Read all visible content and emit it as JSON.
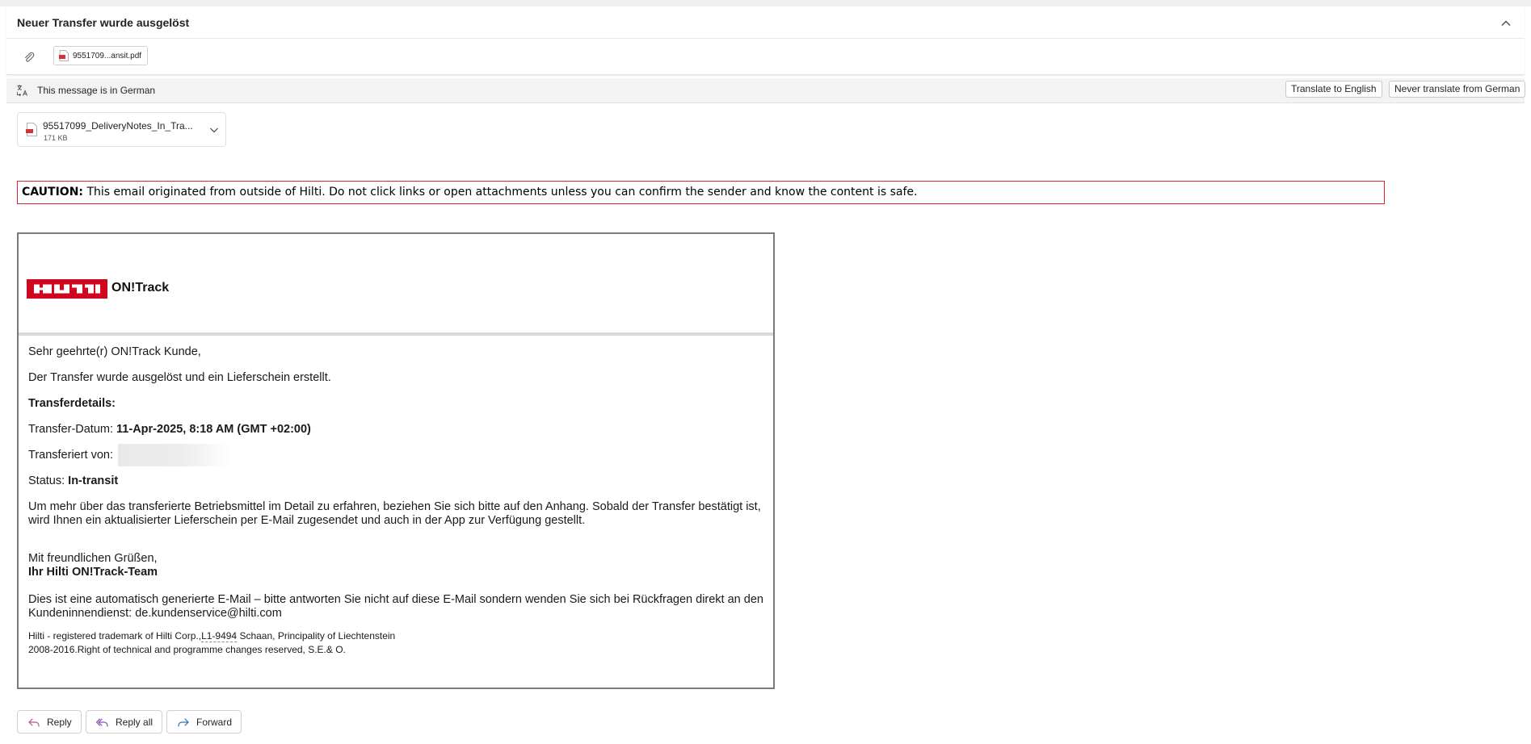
{
  "header": {
    "subject": "Neuer Transfer wurde ausgelöst",
    "collapse_icon": "chevron-up-icon",
    "attachment_chip": "9551709...ansit.pdf"
  },
  "translation_bar": {
    "message": "This message is in German",
    "translate_button": "Translate to English",
    "never_translate_button": "Never translate from German"
  },
  "attachment": {
    "filename": "95517099_DeliveryNotes_In_Tra...",
    "size": "171 KB"
  },
  "caution": {
    "label": "CAUTION:",
    "text": "This email originated from outside of Hilti. Do not click links or open attachments unless you can confirm the sender and know the content is safe."
  },
  "email": {
    "logo_text": "HILTI",
    "brand": "ON!Track",
    "greeting": "Sehr geehrte(r) ON!Track Kunde,",
    "intro": "Der Transfer wurde ausgelöst und ein Lieferschein erstellt.",
    "details_heading": "Transferdetails:",
    "date_label": "Transfer-Datum:",
    "date_value": "11-Apr-2025, 8:18 AM (GMT +02:00)",
    "from_label": "Transferiert von:",
    "status_label": "Status:",
    "status_value": "In-transit",
    "body": "Um mehr über das transferierte Betriebsmittel im Detail zu erfahren, beziehen Sie sich bitte auf den Anhang. Sobald der Transfer bestätigt ist, wird Ihnen ein aktualisierter Lieferschein per E-Mail zugesendet und auch in der App zur Verfügung gestellt.",
    "closing": "Mit freundlichen Grüßen,",
    "signature": "Ihr Hilti ON!Track-Team",
    "auto_notice": "Dies ist eine automatisch generierte E-Mail – bitte antworten Sie nicht auf diese E-Mail sondern wenden Sie sich bei Rückfragen direkt an den Kundeninnendienst: de.kundenservice@hilti.com",
    "trademark_pre": "Hilti - registered trademark of Hilti Corp.,",
    "trademark_code": "L1-9494",
    "trademark_post": "Schaan, Principality of Liechtenstein",
    "copyright": "2008-2016.Right of technical and programme changes reserved, S.E.& O."
  },
  "actions": {
    "reply": "Reply",
    "reply_all": "Reply all",
    "forward": "Forward"
  },
  "colors": {
    "caution_border": "#e0262f",
    "hilti_red": "#d2051e"
  }
}
